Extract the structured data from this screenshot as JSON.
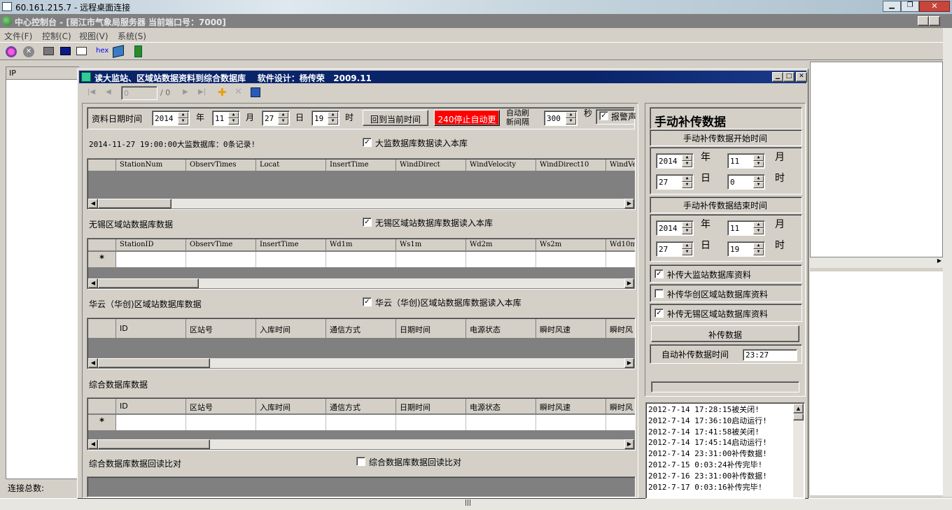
{
  "rdp": {
    "title": "60.161.215.7 - 远程桌面连接"
  },
  "app": {
    "title": "中心控制台 - [丽江市气象局服务器 当前端口号：7000]",
    "menu": [
      "文件(F)",
      "控制(C)",
      "视图(V)",
      "系统(S)"
    ],
    "toolbar": {
      "hex": "hex"
    }
  },
  "left": {
    "ip_header": "IP",
    "status": "连接总数:"
  },
  "dialog": {
    "title": "读大监站、区域站数据资料到综合数据库    软件设计：杨传荣   2009.11",
    "nav": {
      "position": "0",
      "of": "/ 0"
    },
    "top": {
      "date_label": "资料日期时间",
      "year": "2014",
      "year_unit": "年",
      "month": "11",
      "month_unit": "月",
      "day": "27",
      "day_unit": "日",
      "hour": "19",
      "hour_unit": "时",
      "current_time_btn": "回到当前时间",
      "stop_btn": "240停止自动更",
      "refresh_label_1": "自动刷",
      "refresh_label_2": "新间隔",
      "refresh_value": "300",
      "refresh_unit": "秒",
      "alarm": "报警声"
    },
    "s1": {
      "status": "2014-11-27 19:00:00大监数据库：0条记录!",
      "check": "大监数据库数据读入本库",
      "cols": [
        "StationNum",
        "ObservTimes",
        "Locat",
        "InsertTime",
        "WindDirect",
        "WindVelocity",
        "WindDirect10",
        "WindVe"
      ]
    },
    "s2": {
      "title": "无锡区域站数据库数据",
      "check": "无锡区域站数据库数据读入本库",
      "cols": [
        "StationID",
        "ObservTime",
        "InsertTime",
        "Wd1m",
        "Ws1m",
        "Wd2m",
        "Ws2m",
        "Wd10m"
      ],
      "newrow": "*"
    },
    "s3": {
      "title": "华云（华创)区域站数据库数据",
      "check": "华云（华创)区域站数据库数据读入本库",
      "cols": [
        "ID",
        "区站号",
        "入库时间",
        "通信方式",
        "日期时间",
        "电源状态",
        "瞬时风速",
        "瞬时风"
      ]
    },
    "s4": {
      "title": "综合数据库数据",
      "cols": [
        "ID",
        "区站号",
        "入库时间",
        "通信方式",
        "日期时间",
        "电源状态",
        "瞬时风速",
        "瞬时风"
      ],
      "newrow": "*"
    },
    "s5": {
      "title": "综合数据库数据回读比对",
      "check": "综合数据库数据回读比对"
    },
    "manual": {
      "title": "手动补传数据",
      "start_title": "手动补传数据开始时间",
      "start": {
        "year": "2014",
        "month": "11",
        "day": "27",
        "hour": "0"
      },
      "end_title": "手动补传数据结束时间",
      "end": {
        "year": "2014",
        "month": "11",
        "day": "27",
        "hour": "19"
      },
      "u_year": "年",
      "u_month": "月",
      "u_day": "日",
      "u_hour": "时",
      "chk1": "补传大监站数据库资料",
      "chk2": "补传华创区域站数据库资料",
      "chk3": "补传无锡区域站数据库资料",
      "btn": "补传数据",
      "auto_label": "自动补传数据时间",
      "auto_value": "23:27"
    },
    "log": [
      "2012-7-14 17:28:15被关闭!",
      "2012-7-14 17:36:10启动运行!",
      "2012-7-14 17:41:58被关闭!",
      "2012-7-14 17:45:14启动运行!",
      "2012-7-14 23:31:00补传数据!",
      "2012-7-15 0:03:24补传完毕!",
      "2012-7-16 23:31:00补传数据!",
      "2012-7-17 0:03:16补传完毕!"
    ]
  }
}
